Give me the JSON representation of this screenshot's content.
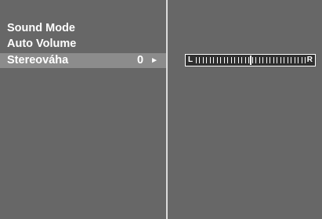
{
  "menu": {
    "items": [
      {
        "label": "Sound Mode"
      },
      {
        "label": "Auto Volume"
      },
      {
        "label": "Stereováha",
        "value": "0",
        "arrow": "►"
      }
    ]
  },
  "balance": {
    "left_label": "L",
    "right_label": "R",
    "level": 0
  },
  "colors": {
    "background": "#676767",
    "highlight": "#8c8c8c",
    "text": "#ffffff"
  }
}
